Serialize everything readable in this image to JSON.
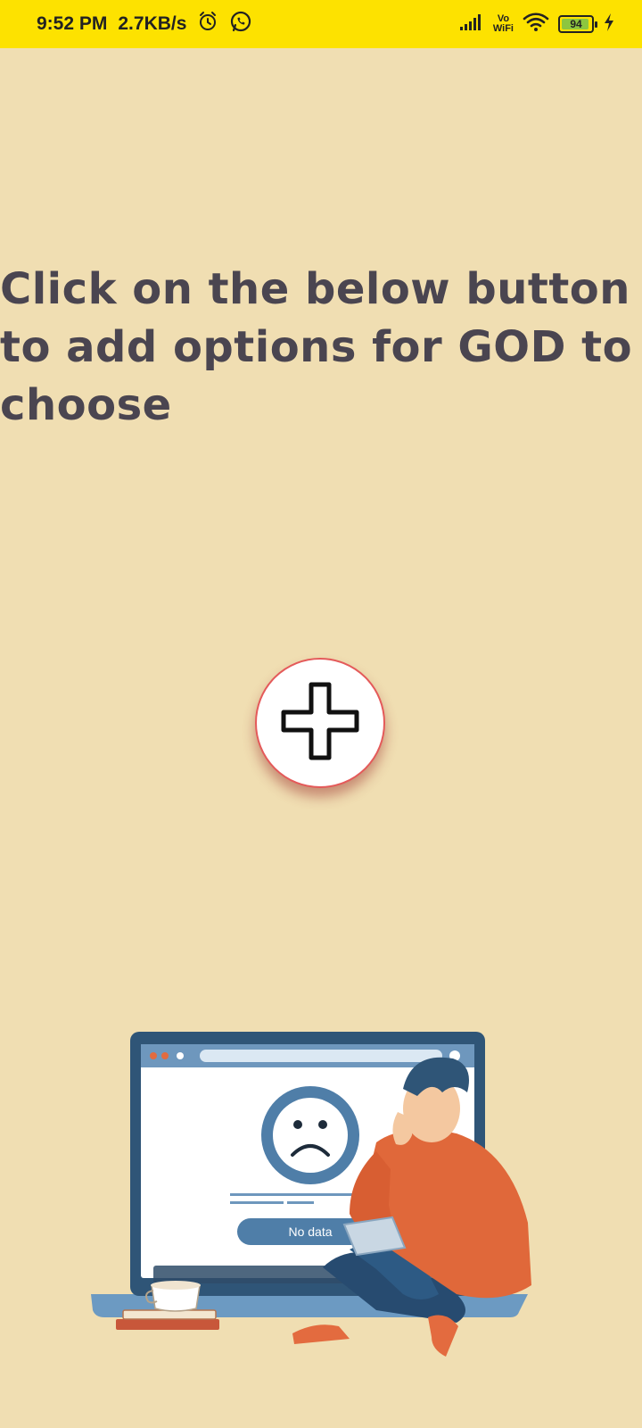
{
  "status_bar": {
    "time": "9:52 PM",
    "net_speed": "2.7KB/s",
    "volte_top": "Vo",
    "volte_bottom": "WiFi",
    "battery_level": "94",
    "icons": [
      "alarm-icon",
      "whatsapp-icon",
      "signal-icon",
      "wifi-icon",
      "battery-icon",
      "charging-icon"
    ]
  },
  "main": {
    "prompt": "Click on the below button to add options for GOD to choose",
    "add_button_icon": "plus-icon"
  },
  "illustration": {
    "no_data_label": "No data"
  },
  "colors": {
    "background": "#f0deb2",
    "status_bar": "#fde200",
    "text": "#4a4550",
    "button_border": "#e45a5a"
  }
}
